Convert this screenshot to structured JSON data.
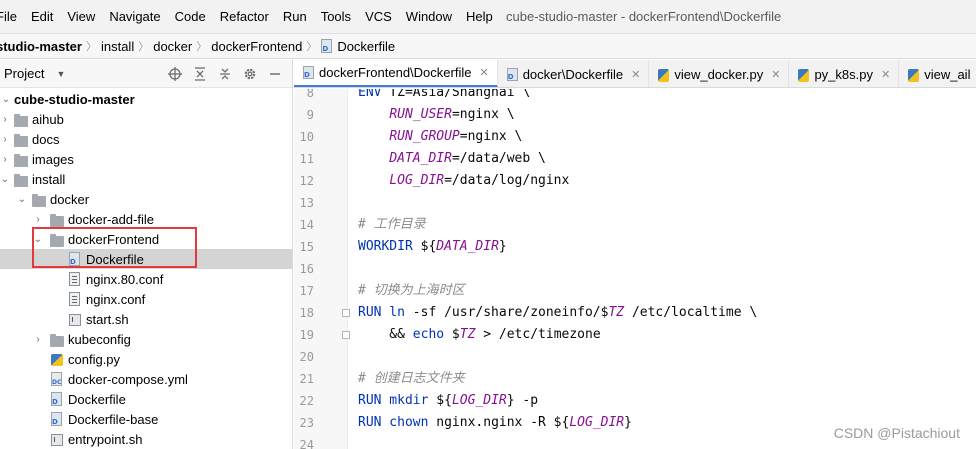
{
  "menu": [
    "File",
    "Edit",
    "View",
    "Navigate",
    "Code",
    "Refactor",
    "Run",
    "Tools",
    "VCS",
    "Window",
    "Help"
  ],
  "window_title": "cube-studio-master - dockerFrontend\\Dockerfile",
  "breadcrumb": {
    "project": "studio-master",
    "parts": [
      "install",
      "docker",
      "dockerFrontend"
    ],
    "file": "Dockerfile"
  },
  "project_panel": {
    "title": "Project",
    "tree": [
      {
        "label": "cube-studio-master",
        "kind": "root"
      },
      {
        "label": "aihub",
        "kind": "folder"
      },
      {
        "label": "docs",
        "kind": "folder"
      },
      {
        "label": "images",
        "kind": "folder"
      },
      {
        "label": "install",
        "kind": "folder"
      },
      {
        "label": "docker",
        "kind": "folder"
      },
      {
        "label": "docker-add-file",
        "kind": "folder"
      },
      {
        "label": "dockerFrontend",
        "kind": "folder"
      },
      {
        "label": "Dockerfile",
        "kind": "dockerfile"
      },
      {
        "label": "nginx.80.conf",
        "kind": "conf"
      },
      {
        "label": "nginx.conf",
        "kind": "conf"
      },
      {
        "label": "start.sh",
        "kind": "sh"
      },
      {
        "label": "kubeconfig",
        "kind": "folder"
      },
      {
        "label": "config.py",
        "kind": "py"
      },
      {
        "label": "docker-compose.yml",
        "kind": "yml"
      },
      {
        "label": "Dockerfile",
        "kind": "dockerfile"
      },
      {
        "label": "Dockerfile-base",
        "kind": "dockerfile"
      },
      {
        "label": "entrypoint.sh",
        "kind": "sh"
      }
    ]
  },
  "tabs": [
    {
      "label": "dockerFrontend\\Dockerfile",
      "active": true
    },
    {
      "label": "docker\\Dockerfile",
      "active": false
    },
    {
      "label": "view_docker.py",
      "active": false
    },
    {
      "label": "py_k8s.py",
      "active": false
    },
    {
      "label": "view_ail",
      "active": false
    }
  ],
  "editor": {
    "line_numbers": [
      "8",
      "9",
      "10",
      "11",
      "12",
      "13",
      "14",
      "15",
      "16",
      "17",
      "18",
      "19",
      "20",
      "21",
      "22",
      "23",
      "24"
    ],
    "lines": [
      {
        "key": "ENV",
        "rest": " TZ=Asia/Shanghai \\"
      },
      {
        "var": "RUN_USER",
        "rest": "=nginx \\"
      },
      {
        "var": "RUN_GROUP",
        "rest": "=nginx \\"
      },
      {
        "var": "DATA_DIR",
        "rest": "=/data/web \\"
      },
      {
        "var": "LOG_DIR",
        "rest": "=/data/log/nginx"
      },
      {},
      {
        "comment": "# 工作目录"
      },
      {
        "key": "WORKDIR",
        "pre": " ${",
        "var": "DATA_DIR",
        "rest": "}"
      },
      {},
      {
        "comment": "# 切换为上海时区"
      },
      {
        "key": "RUN",
        "cmd": " ln",
        "mid": " -sf /usr/share/zoneinfo/$",
        "var": "TZ",
        "rest": " /etc/localtime \\"
      },
      {
        "pre": "    && ",
        "cmd": "echo",
        "mid": " $",
        "var": "TZ",
        "rest": " > /etc/timezone"
      },
      {},
      {
        "comment": "# 创建日志文件夹"
      },
      {
        "key": "RUN",
        "cmd": " mkdir",
        "mid": " ${",
        "var": "LOG_DIR",
        "rest": "} -p"
      },
      {
        "key": "RUN",
        "cmd": " chown",
        "mid": " nginx.nginx -R ${",
        "var": "LOG_DIR",
        "rest": "}"
      },
      {}
    ]
  },
  "watermark": "CSDN @Pistachiout"
}
